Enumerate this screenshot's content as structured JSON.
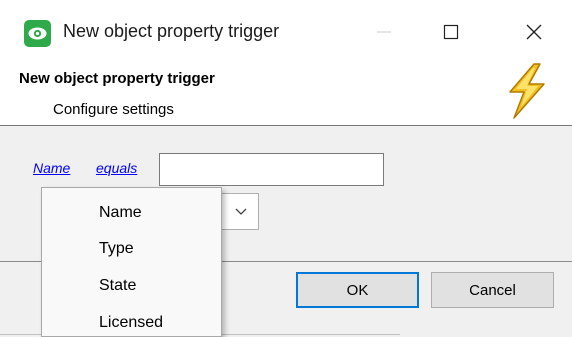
{
  "window": {
    "title": "New object property trigger",
    "icon": "eye-app-icon"
  },
  "header": {
    "title": "New object property trigger",
    "subtitle": "Configure settings",
    "icon": "lightning-icon"
  },
  "condition": {
    "property_link": "Name",
    "operator_link": "equals",
    "value": ""
  },
  "dropdown": {
    "items": [
      "Name",
      "Type",
      "State",
      "Licensed"
    ]
  },
  "buttons": {
    "ok": "OK",
    "cancel": "Cancel"
  },
  "colors": {
    "link": "#0000ff",
    "ok_border": "#0078d7",
    "app_icon": "#2eaa4a",
    "lightning": "#f4c020"
  }
}
